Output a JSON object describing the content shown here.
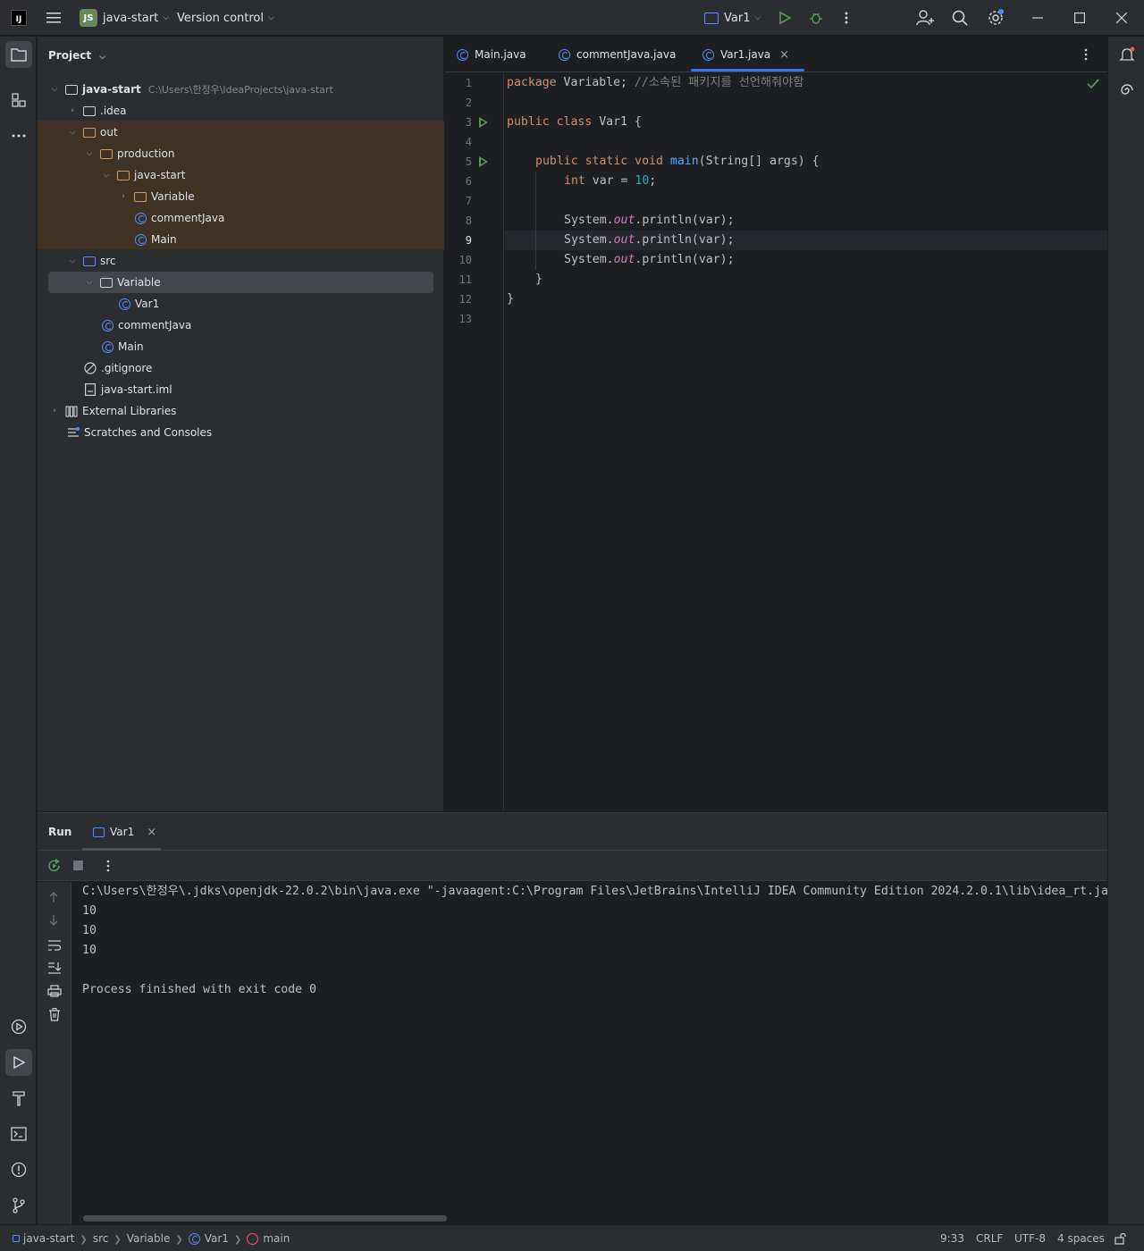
{
  "titlebar": {
    "project_badge": "JS",
    "project_name": "java-start",
    "vcs_label": "Version control",
    "run_config": "Var1"
  },
  "project_panel": {
    "title": "Project",
    "tree": [
      {
        "label": "java-start",
        "hint": "C:\\Users\\한정우\\IdeaProjects\\java-start"
      },
      {
        "label": ".idea"
      },
      {
        "label": "out"
      },
      {
        "label": "production"
      },
      {
        "label": "java-start"
      },
      {
        "label": "Variable"
      },
      {
        "label": "commentJava"
      },
      {
        "label": "Main"
      },
      {
        "label": "src"
      },
      {
        "label": "Variable"
      },
      {
        "label": "Var1"
      },
      {
        "label": "commentJava"
      },
      {
        "label": "Main"
      },
      {
        "label": ".gitignore"
      },
      {
        "label": "java-start.iml"
      },
      {
        "label": "External Libraries"
      },
      {
        "label": "Scratches and Consoles"
      }
    ]
  },
  "editor": {
    "tabs": [
      {
        "label": "Main.java"
      },
      {
        "label": "commentJava.java"
      },
      {
        "label": "Var1.java"
      }
    ],
    "line_numbers": [
      "1",
      "2",
      "3",
      "4",
      "5",
      "6",
      "7",
      "8",
      "9",
      "10",
      "11",
      "12",
      "13"
    ],
    "current_line": "9",
    "code": {
      "l1_kw": "package",
      "l1_rest": " Variable; ",
      "l1_cmt": "//소속된 패키지를 선언해줘야함",
      "l3_kw": "public class",
      "l3_rest": " Var1 {",
      "l5_kw": "public static void",
      "l5_fn": "main",
      "l5_rest": "(String[] args) {",
      "l6_kw": "int",
      "l6_rest": " var = ",
      "l6_num": "10",
      "l6_end": ";",
      "sys": "System.",
      "out": "out",
      "println": ".println(var);",
      "l11": "}",
      "l12": "}"
    }
  },
  "run_panel": {
    "title": "Run",
    "tab_label": "Var1",
    "console": [
      "C:\\Users\\한정우\\.jdks\\openjdk-22.0.2\\bin\\java.exe \"-javaagent:C:\\Program Files\\JetBrains\\IntelliJ IDEA Community Edition 2024.2.0.1\\lib\\idea_rt.jar",
      "10",
      "10",
      "10",
      "",
      "Process finished with exit code 0"
    ]
  },
  "statusbar": {
    "crumbs": [
      "java-start",
      "src",
      "Variable",
      "Var1",
      "main"
    ],
    "position": "9:33",
    "line_ending": "CRLF",
    "encoding": "UTF-8",
    "indent": "4 spaces"
  }
}
